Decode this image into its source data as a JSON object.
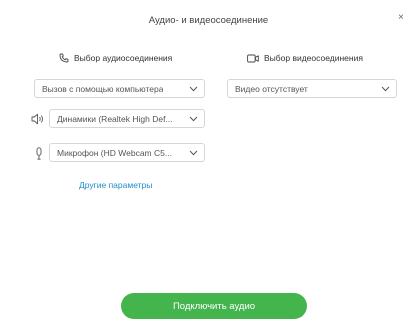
{
  "dialog": {
    "title": "Аудио- и видеосоединение",
    "close_label": "×"
  },
  "audio": {
    "header": "Выбор аудиосоединения",
    "header_icon": "phone-icon",
    "connection_mode": "Вызов с помощью компьютера",
    "speaker": "Динамики (Realtek High Def...",
    "speaker_icon": "speaker-icon",
    "microphone": "Микрофон (HD Webcam C5...",
    "microphone_icon": "microphone-icon",
    "more_link": "Другие параметры"
  },
  "video": {
    "header": "Выбор видеосоединения",
    "header_icon": "video-camera-icon",
    "connection_mode": "Видео отсутствует"
  },
  "actions": {
    "connect_label": "Подключить аудио"
  },
  "colors": {
    "primary_button": "#43b54c",
    "link": "#1f8fc9"
  }
}
